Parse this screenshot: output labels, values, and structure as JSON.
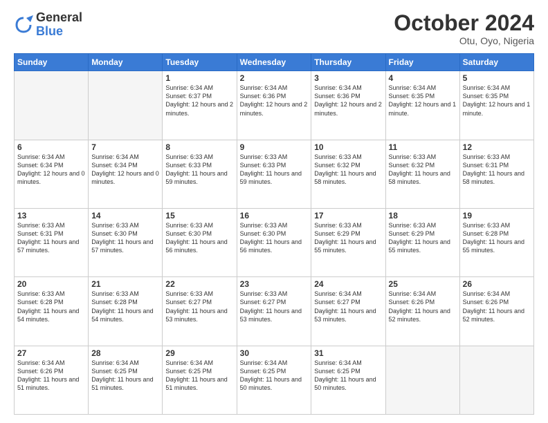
{
  "logo": {
    "general": "General",
    "blue": "Blue"
  },
  "title": "October 2024",
  "subtitle": "Otu, Oyo, Nigeria",
  "days_header": [
    "Sunday",
    "Monday",
    "Tuesday",
    "Wednesday",
    "Thursday",
    "Friday",
    "Saturday"
  ],
  "weeks": [
    [
      {
        "day": "",
        "sunrise": "",
        "sunset": "",
        "daylight": ""
      },
      {
        "day": "",
        "sunrise": "",
        "sunset": "",
        "daylight": ""
      },
      {
        "day": "1",
        "sunrise": "Sunrise: 6:34 AM",
        "sunset": "Sunset: 6:37 PM",
        "daylight": "Daylight: 12 hours and 2 minutes."
      },
      {
        "day": "2",
        "sunrise": "Sunrise: 6:34 AM",
        "sunset": "Sunset: 6:36 PM",
        "daylight": "Daylight: 12 hours and 2 minutes."
      },
      {
        "day": "3",
        "sunrise": "Sunrise: 6:34 AM",
        "sunset": "Sunset: 6:36 PM",
        "daylight": "Daylight: 12 hours and 2 minutes."
      },
      {
        "day": "4",
        "sunrise": "Sunrise: 6:34 AM",
        "sunset": "Sunset: 6:35 PM",
        "daylight": "Daylight: 12 hours and 1 minute."
      },
      {
        "day": "5",
        "sunrise": "Sunrise: 6:34 AM",
        "sunset": "Sunset: 6:35 PM",
        "daylight": "Daylight: 12 hours and 1 minute."
      }
    ],
    [
      {
        "day": "6",
        "sunrise": "Sunrise: 6:34 AM",
        "sunset": "Sunset: 6:34 PM",
        "daylight": "Daylight: 12 hours and 0 minutes."
      },
      {
        "day": "7",
        "sunrise": "Sunrise: 6:34 AM",
        "sunset": "Sunset: 6:34 PM",
        "daylight": "Daylight: 12 hours and 0 minutes."
      },
      {
        "day": "8",
        "sunrise": "Sunrise: 6:33 AM",
        "sunset": "Sunset: 6:33 PM",
        "daylight": "Daylight: 11 hours and 59 minutes."
      },
      {
        "day": "9",
        "sunrise": "Sunrise: 6:33 AM",
        "sunset": "Sunset: 6:33 PM",
        "daylight": "Daylight: 11 hours and 59 minutes."
      },
      {
        "day": "10",
        "sunrise": "Sunrise: 6:33 AM",
        "sunset": "Sunset: 6:32 PM",
        "daylight": "Daylight: 11 hours and 58 minutes."
      },
      {
        "day": "11",
        "sunrise": "Sunrise: 6:33 AM",
        "sunset": "Sunset: 6:32 PM",
        "daylight": "Daylight: 11 hours and 58 minutes."
      },
      {
        "day": "12",
        "sunrise": "Sunrise: 6:33 AM",
        "sunset": "Sunset: 6:31 PM",
        "daylight": "Daylight: 11 hours and 58 minutes."
      }
    ],
    [
      {
        "day": "13",
        "sunrise": "Sunrise: 6:33 AM",
        "sunset": "Sunset: 6:31 PM",
        "daylight": "Daylight: 11 hours and 57 minutes."
      },
      {
        "day": "14",
        "sunrise": "Sunrise: 6:33 AM",
        "sunset": "Sunset: 6:30 PM",
        "daylight": "Daylight: 11 hours and 57 minutes."
      },
      {
        "day": "15",
        "sunrise": "Sunrise: 6:33 AM",
        "sunset": "Sunset: 6:30 PM",
        "daylight": "Daylight: 11 hours and 56 minutes."
      },
      {
        "day": "16",
        "sunrise": "Sunrise: 6:33 AM",
        "sunset": "Sunset: 6:30 PM",
        "daylight": "Daylight: 11 hours and 56 minutes."
      },
      {
        "day": "17",
        "sunrise": "Sunrise: 6:33 AM",
        "sunset": "Sunset: 6:29 PM",
        "daylight": "Daylight: 11 hours and 55 minutes."
      },
      {
        "day": "18",
        "sunrise": "Sunrise: 6:33 AM",
        "sunset": "Sunset: 6:29 PM",
        "daylight": "Daylight: 11 hours and 55 minutes."
      },
      {
        "day": "19",
        "sunrise": "Sunrise: 6:33 AM",
        "sunset": "Sunset: 6:28 PM",
        "daylight": "Daylight: 11 hours and 55 minutes."
      }
    ],
    [
      {
        "day": "20",
        "sunrise": "Sunrise: 6:33 AM",
        "sunset": "Sunset: 6:28 PM",
        "daylight": "Daylight: 11 hours and 54 minutes."
      },
      {
        "day": "21",
        "sunrise": "Sunrise: 6:33 AM",
        "sunset": "Sunset: 6:28 PM",
        "daylight": "Daylight: 11 hours and 54 minutes."
      },
      {
        "day": "22",
        "sunrise": "Sunrise: 6:33 AM",
        "sunset": "Sunset: 6:27 PM",
        "daylight": "Daylight: 11 hours and 53 minutes."
      },
      {
        "day": "23",
        "sunrise": "Sunrise: 6:33 AM",
        "sunset": "Sunset: 6:27 PM",
        "daylight": "Daylight: 11 hours and 53 minutes."
      },
      {
        "day": "24",
        "sunrise": "Sunrise: 6:34 AM",
        "sunset": "Sunset: 6:27 PM",
        "daylight": "Daylight: 11 hours and 53 minutes."
      },
      {
        "day": "25",
        "sunrise": "Sunrise: 6:34 AM",
        "sunset": "Sunset: 6:26 PM",
        "daylight": "Daylight: 11 hours and 52 minutes."
      },
      {
        "day": "26",
        "sunrise": "Sunrise: 6:34 AM",
        "sunset": "Sunset: 6:26 PM",
        "daylight": "Daylight: 11 hours and 52 minutes."
      }
    ],
    [
      {
        "day": "27",
        "sunrise": "Sunrise: 6:34 AM",
        "sunset": "Sunset: 6:26 PM",
        "daylight": "Daylight: 11 hours and 51 minutes."
      },
      {
        "day": "28",
        "sunrise": "Sunrise: 6:34 AM",
        "sunset": "Sunset: 6:25 PM",
        "daylight": "Daylight: 11 hours and 51 minutes."
      },
      {
        "day": "29",
        "sunrise": "Sunrise: 6:34 AM",
        "sunset": "Sunset: 6:25 PM",
        "daylight": "Daylight: 11 hours and 51 minutes."
      },
      {
        "day": "30",
        "sunrise": "Sunrise: 6:34 AM",
        "sunset": "Sunset: 6:25 PM",
        "daylight": "Daylight: 11 hours and 50 minutes."
      },
      {
        "day": "31",
        "sunrise": "Sunrise: 6:34 AM",
        "sunset": "Sunset: 6:25 PM",
        "daylight": "Daylight: 11 hours and 50 minutes."
      },
      {
        "day": "",
        "sunrise": "",
        "sunset": "",
        "daylight": ""
      },
      {
        "day": "",
        "sunrise": "",
        "sunset": "",
        "daylight": ""
      }
    ]
  ]
}
